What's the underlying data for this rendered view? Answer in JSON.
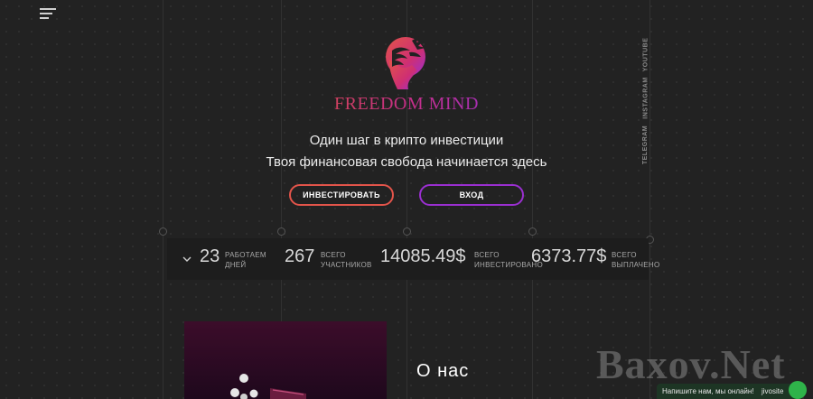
{
  "nav": {
    "menu_icon": "hamburger-menu-icon"
  },
  "social": {
    "youtube": "YOUTUBE",
    "instagram": "INSTAGRAM",
    "telegram": "TELEGRAM"
  },
  "brand": {
    "name": "FREEDOM MIND",
    "logo_icon": "profile-head-logo-icon",
    "colors": {
      "red": "#e2544a",
      "pink": "#c62f86",
      "purple": "#9a2fd0"
    }
  },
  "hero": {
    "tagline_1": "Один шаг в крипто инвестиции",
    "tagline_2": "Твоя финансовая свобода начинается здесь"
  },
  "buttons": {
    "invest": "ИНВЕСТИРОВАТЬ",
    "login": "ВХОД"
  },
  "stats": {
    "chevron_icon": "chevron-down-icon",
    "items": [
      {
        "value": "23",
        "label_1": "РАБОТАЕМ",
        "label_2": "ДНЕЙ"
      },
      {
        "value": "267",
        "label_1": "ВСЕГО",
        "label_2": "УЧАСТНИКОВ"
      },
      {
        "value": "14085.49$",
        "label_1": "ВСЕГО",
        "label_2": "ИНВЕСТИРОВАНО"
      },
      {
        "value": "6373.77$",
        "label_1": "ВСЕГО",
        "label_2": "ВЫПЛАЧЕНО"
      }
    ]
  },
  "about": {
    "title": "О нас"
  },
  "watermark": "Baxov.Net",
  "chat": {
    "text": "Напишите нам, мы онлайн!",
    "brand": "jivosite"
  }
}
